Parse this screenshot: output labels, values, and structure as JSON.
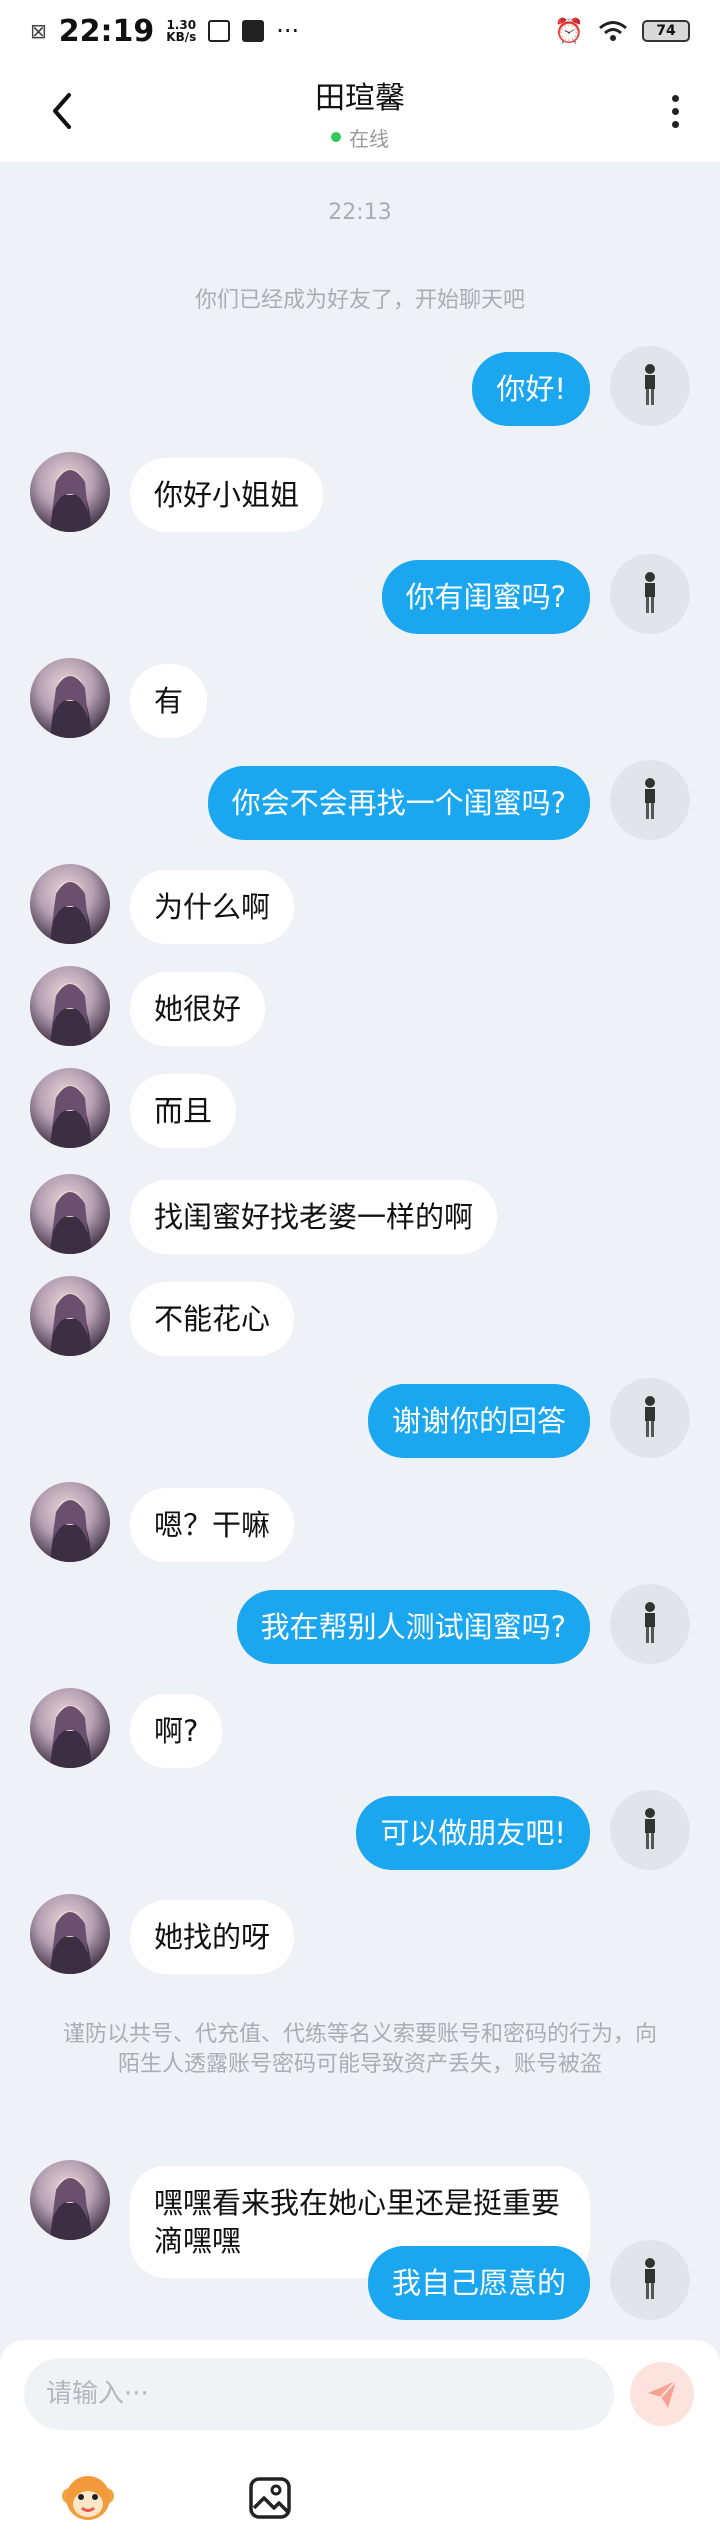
{
  "status_bar": {
    "time": "22:19",
    "net_speed_value": "1.30",
    "net_speed_unit": "KB/s",
    "more": "···",
    "battery": "74"
  },
  "header": {
    "title": "田瑄馨",
    "presence": "在线",
    "presence_color": "#2ecc55"
  },
  "chat": {
    "timestamp": "22:13",
    "friend_notice": "你们已经成为好友了，开始聊天吧",
    "security_notice": "谨防以共号、代充值、代练等名义索要账号和密码的行为，向陌生人透露账号密码可能导致资产丢失，账号被盗",
    "messages": [
      {
        "from": "me",
        "text": "你好!"
      },
      {
        "from": "peer",
        "text": "你好小姐姐"
      },
      {
        "from": "me",
        "text": "你有闺蜜吗?"
      },
      {
        "from": "peer",
        "text": "有"
      },
      {
        "from": "me",
        "text": "你会不会再找一个闺蜜吗?"
      },
      {
        "from": "peer",
        "text": "为什么啊"
      },
      {
        "from": "peer",
        "text": "她很好"
      },
      {
        "from": "peer",
        "text": "而且"
      },
      {
        "from": "peer",
        "text": "找闺蜜好找老婆一样的啊"
      },
      {
        "from": "peer",
        "text": "不能花心"
      },
      {
        "from": "me",
        "text": "谢谢你的回答"
      },
      {
        "from": "peer",
        "text": "嗯？干嘛"
      },
      {
        "from": "me",
        "text": "我在帮别人测试闺蜜吗?"
      },
      {
        "from": "peer",
        "text": "啊?"
      },
      {
        "from": "me",
        "text": "可以做朋友吧!"
      },
      {
        "from": "peer",
        "text": "她找的呀"
      },
      {
        "from": "peer",
        "text": "嘿嘿看来我在她心里还是挺重要滴嘿嘿"
      },
      {
        "from": "me",
        "text": "我自己愿意的"
      }
    ]
  },
  "input": {
    "placeholder": "请输入···"
  },
  "icons": {
    "back": "chevron-left-icon",
    "more": "more-vertical-icon",
    "send": "send-icon",
    "sticker": "monkey-emoji-icon",
    "image": "image-icon",
    "accent_blue": "#1aa7ef",
    "send_color": "#f7a191"
  }
}
